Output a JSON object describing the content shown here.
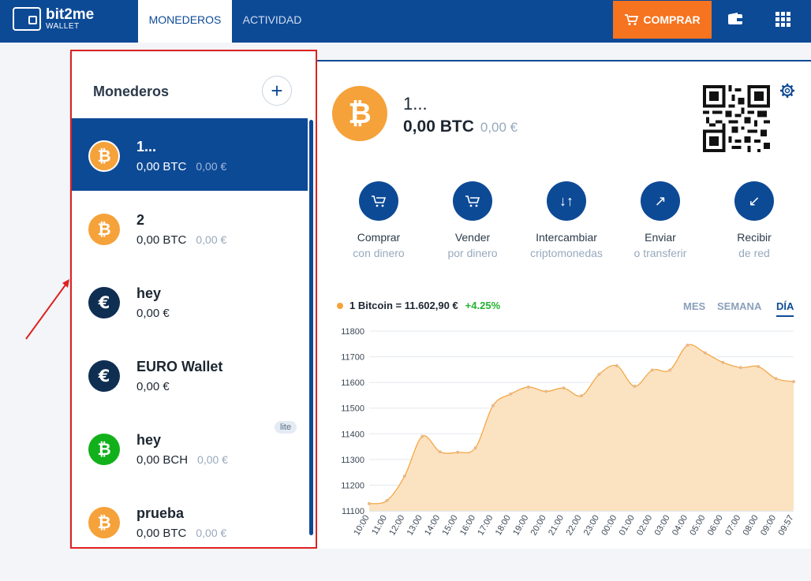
{
  "header": {
    "brand": "bit2me",
    "brand_sub": "WALLET",
    "tabs": [
      {
        "label": "MONEDEROS",
        "active": true
      },
      {
        "label": "ACTIVIDAD",
        "active": false
      }
    ],
    "buy_label": "COMPRAR",
    "accent": "#0d4a96",
    "buy_color": "#f6731f"
  },
  "sidebar": {
    "title": "Monederos",
    "add_icon": "plus-icon",
    "wallets": [
      {
        "name": "1...",
        "balance": "0,00 BTC",
        "eur": "0,00 €",
        "coin": "btc",
        "selected": true
      },
      {
        "name": "2",
        "balance": "0,00 BTC",
        "eur": "0,00 €",
        "coin": "btc"
      },
      {
        "name": "hey",
        "balance": "0,00 €",
        "eur": "",
        "coin": "eur"
      },
      {
        "name": "EURO Wallet",
        "balance": "0,00 €",
        "eur": "",
        "coin": "eur"
      },
      {
        "name": "hey",
        "balance": "0,00 BCH",
        "eur": "0,00 €",
        "coin": "bch",
        "badge": "lite"
      },
      {
        "name": "prueba",
        "balance": "0,00 BTC",
        "eur": "0,00 €",
        "coin": "btc"
      }
    ]
  },
  "main": {
    "wallet_name": "1...",
    "balance": "0,00 BTC",
    "balance_eur": "0,00 €",
    "actions": [
      {
        "label": "Comprar",
        "sub": "con dinero",
        "icon": "cart-buy-icon"
      },
      {
        "label": "Vender",
        "sub": "por dinero",
        "icon": "cart-sell-icon"
      },
      {
        "label": "Intercambiar",
        "sub": "criptomonedas",
        "icon": "swap-icon"
      },
      {
        "label": "Enviar",
        "sub": "o transferir",
        "icon": "send-arrow-icon"
      },
      {
        "label": "Recibir",
        "sub": "de red",
        "icon": "receive-arrow-icon"
      }
    ],
    "price_label": "1 Bitcoin = 11.602,90 €",
    "price_change": "+4.25%",
    "range_tabs": [
      {
        "label": "MES",
        "active": false
      },
      {
        "label": "SEMANA",
        "active": false
      },
      {
        "label": "DÍA",
        "active": true
      }
    ]
  },
  "chart_data": {
    "type": "area",
    "x": [
      "10:00",
      "11:00",
      "12:00",
      "13:00",
      "14:00",
      "15:00",
      "16:00",
      "17:00",
      "18:00",
      "19:00",
      "20:00",
      "21:00",
      "22:00",
      "23:00",
      "00:00",
      "01:00",
      "02:00",
      "03:00",
      "04:00",
      "05:00",
      "06:00",
      "07:00",
      "08:00",
      "09:00",
      "09:57"
    ],
    "values": [
      11128,
      11140,
      11235,
      11390,
      11330,
      11328,
      11345,
      11510,
      11555,
      11582,
      11565,
      11578,
      11548,
      11632,
      11665,
      11585,
      11648,
      11648,
      11745,
      11715,
      11678,
      11658,
      11662,
      11615,
      11603
    ],
    "ylim": [
      11100,
      11800
    ],
    "yticks": [
      11100,
      11200,
      11300,
      11400,
      11500,
      11600,
      11700,
      11800
    ],
    "line_color": "#f5a23a",
    "fill_color": "#fbe3c2",
    "grid": true
  }
}
